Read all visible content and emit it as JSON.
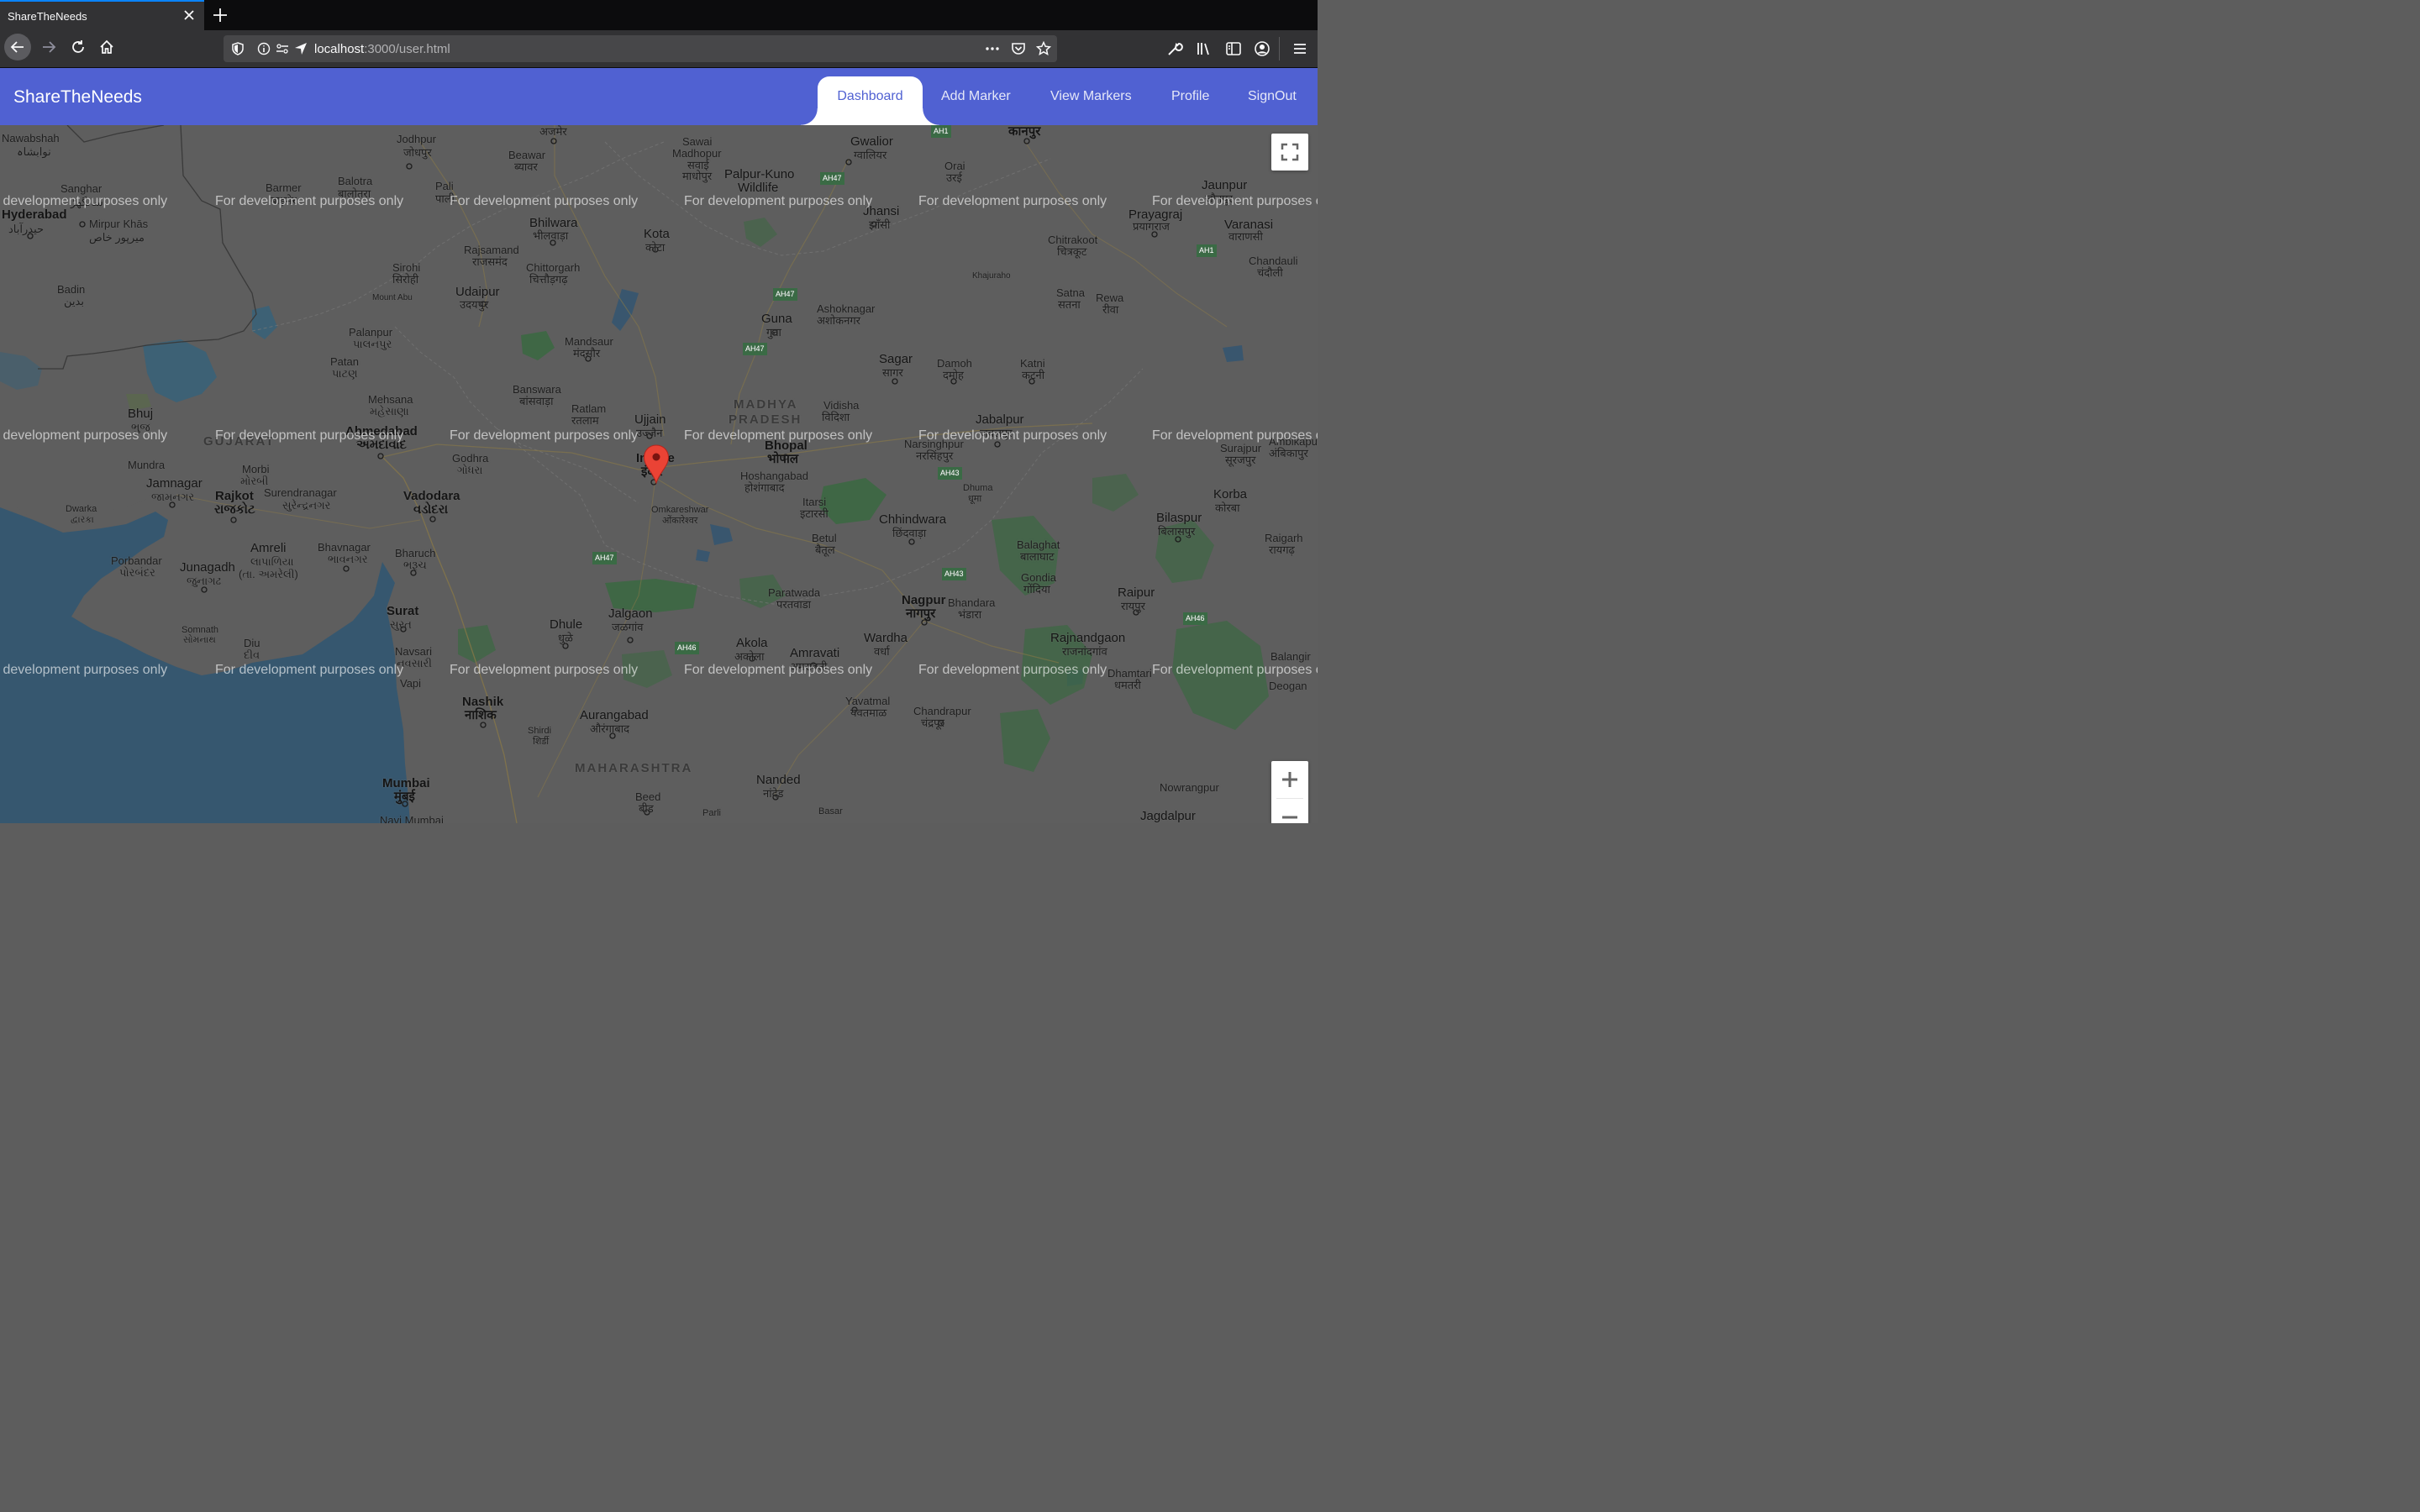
{
  "browser": {
    "tab_title": "ShareTheNeeds",
    "url_host": "localhost",
    "url_path": ":3000/user.html",
    "icons": [
      "close-icon",
      "plus-icon",
      "back-arrow-icon",
      "forward-arrow-icon",
      "reload-icon",
      "home-icon",
      "shield-icon",
      "info-icon",
      "permissions-icon",
      "location-arrow-icon",
      "more-icon",
      "pocket-icon",
      "star-icon",
      "wrench-icon",
      "library-icon",
      "sidebar-icon",
      "account-icon",
      "hamburger-menu-icon"
    ]
  },
  "app": {
    "brand": "ShareTheNeeds",
    "nav": [
      "Dashboard",
      "Add Marker",
      "View Markers",
      "Profile",
      "SignOut"
    ],
    "active_nav": "Dashboard",
    "accent_color": "#5061d2"
  },
  "map": {
    "watermark": "For development purposes only",
    "marker_color": "#ea4335",
    "places": {
      "nawabshah": "Nawabshah",
      "nawabshah_ur": "نوابشاہ",
      "sanghar": "Sanghar",
      "sanghar_ur": "سانگھڑ",
      "hyderabad": "Hyderabad",
      "hyderabad_ur": "حیدرآباد",
      "mirpur": "Mirpur Khās",
      "mirpur_ur": "میرپور خاص",
      "badin": "Badin",
      "badin_ur": "بدین",
      "jodhpur": "Jodhpur",
      "jodhpur_hi": "जोधपुर",
      "ajmer": "अजमेर",
      "beawar": "Beawar",
      "beawar_hi": "ब्यावर",
      "barmer": "Barmer",
      "barmer_hi": "बाड़मेर",
      "balotra": "Balotra",
      "balotra_hi": "बालोतरा",
      "pali": "Pali",
      "pali_hi": "पाली",
      "sawai": "Sawai",
      "madhopur": "Madhopur",
      "sawai_hi": "सवाई",
      "madhopur_hi": "माधोपुर",
      "palpur": "Palpur-Kuno",
      "wildlife": "Wildlife",
      "gwalior": "Gwalior",
      "gwalior_hi": "ग्वालियर",
      "kanpur": "कानपुर",
      "orai": "Orai",
      "orai_hi": "उरई",
      "jaunpur": "Jaunpur",
      "jaunpur_hi": "जौनपुर",
      "bhilwara": "Bhilwara",
      "bhilwara_hi": "भीलवाड़ा",
      "kota": "Kota",
      "kota_hi": "कोटा",
      "jhansi": "Jhansi",
      "jhansi_hi": "झाँसी",
      "prayagraj": "Prayagraj",
      "prayagraj_hi": "प्रयागराज",
      "varanasi": "Varanasi",
      "varanasi_hi": "वाराणसी",
      "rajsamand": "Rajsamand",
      "rajsamand_hi": "राजसमंद",
      "chittorgarh": "Chittorgarh",
      "chittorgarh_hi": "चित्तौड़गढ़",
      "chitrakoot": "Chitrakoot",
      "chitrakoot_hi": "चित्रकूट",
      "chandauli": "Chandauli",
      "chandauli_hi": "चंदौली",
      "sirohi": "Sirohi",
      "sirohi_hi": "सिरोही",
      "udaipur": "Udaipur",
      "udaipur_hi": "उदयपुर",
      "mountabu": "Mount Abu",
      "khajuraho": "Khajuraho",
      "satna": "Satna",
      "satna_hi": "सतना",
      "rewa": "Rewa",
      "rewa_hi": "रीवा",
      "guna": "Guna",
      "guna_hi": "गुना",
      "ashoknagar": "Ashoknagar",
      "ashoknagar_hi": "अशोकनगर",
      "mandsaur": "Mandsaur",
      "mandsaur_hi": "मंदसौर",
      "palanpur": "Palanpur",
      "palanpur_gu": "પાલનપુર",
      "patan": "Patan",
      "patan_gu": "પાટણ",
      "sagar": "Sagar",
      "sagar_hi": "सागर",
      "damoh": "Damoh",
      "damoh_hi": "दमोह",
      "katni": "Katni",
      "katni_hi": "कटनी",
      "mehsana": "Mehsana",
      "mehsana_gu": "મહેસાણા",
      "banswara": "Banswara",
      "banswara_hi": "बांसवाड़ा",
      "ratlam": "Ratlam",
      "ratlam_hi": "रतलाम",
      "madhya": "MADHYA",
      "pradesh": "PRADESH",
      "vidisha": "Vidisha",
      "vidisha_hi": "विदिशा",
      "jabalpur": "Jabalpur",
      "jabalpur_hi": "जबलपुर",
      "bhuj": "Bhuj",
      "bhuj_gu": "ભુજ",
      "gujarat": "GUJARAT",
      "ahmedabad": "Ahmedabad",
      "ahmedabad_gu": "અમદાવાદ",
      "ujjain": "Ujjain",
      "ujjain_hi": "उज्जैन",
      "indore": "Indore",
      "indore_hi": "इंदौर",
      "bhopal": "Bhopal",
      "bhopal_hi": "भोपाल",
      "narsinghpur": "Narsinghpur",
      "narsinghpur_hi": "नरसिंहपुर",
      "surajpur": "Surajpur",
      "surajpur_hi": "सूरजपुर",
      "ambikapur": "Ambikapur",
      "ambikapur_hi": "अंबिकापुर",
      "mundra": "Mundra",
      "morbi": "Morbi",
      "morbi_gu": "મોરબી",
      "godhra": "Godhra",
      "godhra_gu": "ગોધરા",
      "jamnagar": "Jamnagar",
      "jamnagar_gu": "જામનગર",
      "rajkot": "Rajkot",
      "rajkot_gu": "રાજકોટ",
      "surendranagar": "Surendranagar",
      "surendranagar_gu": "સુરેન્દ્રનગર",
      "vadodara": "Vadodara",
      "vadodara_gu": "વડોદરા",
      "hoshangabad": "Hoshangabad",
      "hoshangabad_hi": "होशंगाबाद",
      "dhuma": "Dhuma",
      "dhuma_hi": "धूमा",
      "korba": "Korba",
      "korba_hi": "कोरबा",
      "dwarka": "Dwarka",
      "dwarka_gu": "દ્વારકા",
      "omkareshwar": "Omkareshwar",
      "omkareshwar_hi": "ओंकारेश्वर",
      "itarsi": "Itarsi",
      "itarsi_hi": "इटारसी",
      "chhindwara": "Chhindwara",
      "chhindwara_hi": "छिंदवाड़ा",
      "bilaspur": "Bilaspur",
      "bilaspur_hi": "बिलासपुर",
      "betul": "Betul",
      "betul_hi": "बैतूल",
      "raigarh": "Raigarh",
      "raigarh_hi": "रायगढ़",
      "amreli": "Amreli",
      "amreli_gu": "લાપાળિયા",
      "amreli_gu2": "(તા. અમરેલી)",
      "bhavnagar": "Bhavnagar",
      "bhavnagar_gu": "ભાવનગર",
      "bharuch": "Bharuch",
      "bharuch_gu": "ભરૂચ",
      "balaghat": "Balaghat",
      "balaghat_hi": "बालाघाट",
      "porbandar": "Porbandar",
      "porbandar_gu": "પોરબંદર",
      "junagadh": "Junagadh",
      "junagadh_gu": "જુનાગઢ",
      "gondia": "Gondia",
      "gondia_hi": "गोंदिया",
      "paratwada": "Paratwada",
      "paratwada_hi": "परतवाडा",
      "raipur": "Raipur",
      "raipur_hi": "रायपुर",
      "surat": "Surat",
      "surat_gu": "સુરત",
      "jalgaon": "Jalgaon",
      "jalgaon_mr": "जळगांव",
      "nagpur": "Nagpur",
      "nagpur_mr": "नागपुर",
      "bhandara": "Bhandara",
      "bhandara_mr": "भंडारा",
      "somnath": "Somnath",
      "somnath_gu": "સોમનાથ",
      "diu": "Diu",
      "diu_gu": "દીવ",
      "dhule": "Dhule",
      "dhule_mr": "धुळे",
      "akola": "Akola",
      "akola_mr": "अकोला",
      "amravati": "Amravati",
      "amravati_mr": "अमरावती",
      "wardha": "Wardha",
      "wardha_mr": "वर्धा",
      "rajnandgaon": "Rajnandgaon",
      "rajnandgaon_hi": "राजनांदगांव",
      "balangir": "Balangir",
      "navsari": "Navsari",
      "navsari_gu": "નવસારી",
      "dhamtari": "Dhamtari",
      "dhamtari_hi": "धमतरी",
      "deogan": "Deogan",
      "vapi": "Vapi",
      "yavatmal": "Yavatmal",
      "yavatmal_mr": "यवतमाळ",
      "nashik": "Nashik",
      "nashik_mr": "नाशिक",
      "chandrapur": "Chandrapur",
      "chandrapur_mr": "चंद्रपूर",
      "aurangabad": "Aurangabad",
      "aurangabad_mr": "औरंगाबाद",
      "shirdi": "Shirdi",
      "shirdi_mr": "शिर्डी",
      "maharashtra": "MAHARASHTRA",
      "nanded": "Nanded",
      "nanded_mr": "नांदेड",
      "mumbai": "Mumbai",
      "mumbai_mr": "मुंबई",
      "beed": "Beed",
      "beed_mr": "बीड",
      "navimumbai": "Navi Mumbai",
      "parli": "Parli",
      "basar": "Basar",
      "nowrangpur": "Nowrangpur",
      "jagdalpur": "Jagdalpur"
    },
    "highways": [
      "AH1",
      "AH47",
      "AH43",
      "AH46"
    ]
  }
}
